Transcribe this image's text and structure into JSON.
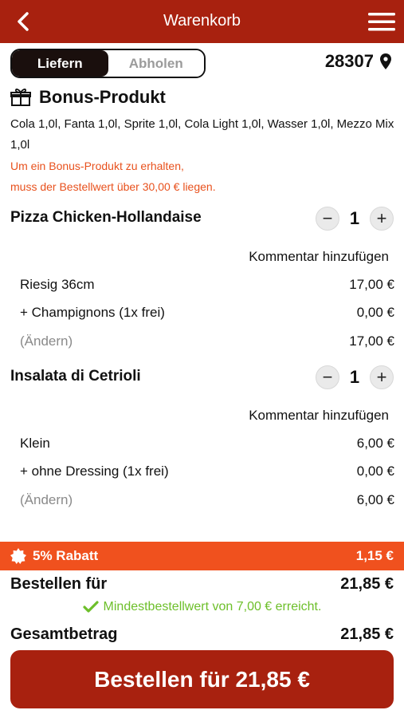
{
  "header": {
    "title": "Warenkorb"
  },
  "delivery": {
    "option_deliver": "Liefern",
    "option_pickup": "Abholen",
    "zip": "28307"
  },
  "bonus": {
    "title": "Bonus-Produkt",
    "items_line1": "Cola 1,0l, Fanta 1,0l, Sprite 1,0l, Cola Light 1,0l, Wasser 1,0l, Mezzo Mix",
    "items_line2": "1,0l",
    "note_line1": "Um ein Bonus-Produkt zu erhalten,",
    "note_line2": "muss der Bestellwert über 30,00 € liegen."
  },
  "products": [
    {
      "name": "Pizza Chicken-Hollandaise",
      "qty": "1",
      "comment": "Kommentar hinzufügen",
      "lines": [
        {
          "label": "Riesig 36cm",
          "price": "17,00 €"
        },
        {
          "label": "+ Champignons (1x frei)",
          "price": "0,00 €"
        },
        {
          "label": "(Ändern)",
          "price": "17,00 €"
        }
      ]
    },
    {
      "name": "Insalata di Cetrioli",
      "qty": "1",
      "comment": "Kommentar hinzufügen",
      "lines": [
        {
          "label": "Klein",
          "price": "6,00 €"
        },
        {
          "label": "+ ohne Dressing (1x frei)",
          "price": "0,00 €"
        },
        {
          "label": "(Ändern)",
          "price": "6,00 €"
        }
      ]
    }
  ],
  "stepper": {
    "minus": "−",
    "plus": "+"
  },
  "discount": {
    "label": "5% Rabatt",
    "amount": "1,15 €"
  },
  "summary": {
    "order_for_label": "Bestellen für",
    "order_for_value": "21,85 €",
    "min_order_msg": "Mindestbestellwert von 7,00 € erreicht.",
    "total_label": "Gesamtbetrag",
    "total_value": "21,85 €"
  },
  "order_button": {
    "label": "Bestellen für 21,85 €"
  },
  "colors": {
    "brand": "#a8210f",
    "discount": "#f0511e",
    "note": "#e8511d",
    "success": "#6dbf2a"
  },
  "icons": [
    "back-arrow-icon",
    "hamburger-menu-icon",
    "location-pin-icon",
    "gift-icon",
    "badge-icon",
    "checkmark-icon"
  ]
}
